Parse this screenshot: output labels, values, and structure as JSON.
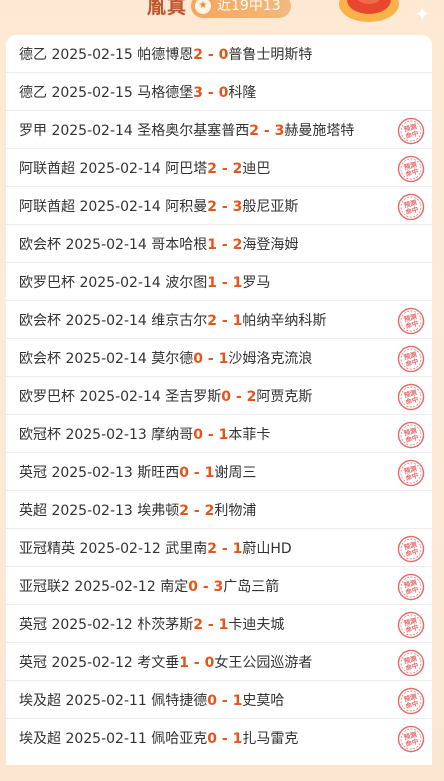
{
  "header": {
    "title": "胤真",
    "badge_icon": "★",
    "badge_text": "近19中13"
  },
  "matches": [
    {
      "league": "德乙",
      "date": "2025-02-15",
      "home": "帕德博恩",
      "home_score": "2",
      "sep": " - ",
      "away_score": "0",
      "away": "普鲁士明斯特",
      "stamp": false
    },
    {
      "league": "德乙",
      "date": "2025-02-15",
      "home": "马格德堡",
      "home_score": "3",
      "sep": " - ",
      "away_score": "0",
      "away": "科隆",
      "stamp": false
    },
    {
      "league": "罗甲",
      "date": "2025-02-14",
      "home": "圣格奥尔基塞普西",
      "home_score": "2",
      "sep": " - ",
      "away_score": "3",
      "away": "赫曼施塔特",
      "stamp": true
    },
    {
      "league": "阿联酋超",
      "date": "2025-02-14",
      "home": "阿巴塔",
      "home_score": "2",
      "sep": " - ",
      "away_score": "2",
      "away": "迪巴",
      "stamp": true
    },
    {
      "league": "阿联酋超",
      "date": "2025-02-14",
      "home": "阿积曼",
      "home_score": "2",
      "sep": " - ",
      "away_score": "3",
      "away": "般尼亚斯",
      "stamp": true
    },
    {
      "league": "欧会杯",
      "date": "2025-02-14",
      "home": "哥本哈根",
      "home_score": "1",
      "sep": " - ",
      "away_score": "2",
      "away": "海登海姆",
      "stamp": false
    },
    {
      "league": "欧罗巴杯",
      "date": "2025-02-14",
      "home": "波尔图",
      "home_score": "1",
      "sep": " - ",
      "away_score": "1",
      "away": "罗马",
      "stamp": false
    },
    {
      "league": "欧会杯",
      "date": "2025-02-14",
      "home": "维京古尔",
      "home_score": "2",
      "sep": " - ",
      "away_score": "1",
      "away": "帕纳辛纳科斯",
      "stamp": true
    },
    {
      "league": "欧会杯",
      "date": "2025-02-14",
      "home": "莫尔德",
      "home_score": "0",
      "sep": " - ",
      "away_score": "1",
      "away": "沙姆洛克流浪",
      "stamp": true
    },
    {
      "league": "欧罗巴杯",
      "date": "2025-02-14",
      "home": "圣吉罗斯",
      "home_score": "0",
      "sep": " - ",
      "away_score": "2",
      "away": "阿贾克斯",
      "stamp": true
    },
    {
      "league": "欧冠杯",
      "date": "2025-02-13",
      "home": "摩纳哥",
      "home_score": "0",
      "sep": " - ",
      "away_score": "1",
      "away": "本菲卡",
      "stamp": true
    },
    {
      "league": "英冠",
      "date": "2025-02-13",
      "home": "斯旺西",
      "home_score": "0",
      "sep": " - ",
      "away_score": "1",
      "away": "谢周三",
      "stamp": true
    },
    {
      "league": "英超",
      "date": "2025-02-13",
      "home": "埃弗顿",
      "home_score": "2",
      "sep": " - ",
      "away_score": "2",
      "away": "利物浦",
      "stamp": false
    },
    {
      "league": "亚冠精英",
      "date": "2025-02-12",
      "home": "武里南",
      "home_score": "2",
      "sep": " - ",
      "away_score": "1",
      "away": "蔚山HD",
      "stamp": true
    },
    {
      "league": "亚冠联2",
      "date": "2025-02-12",
      "home": "南定",
      "home_score": "0",
      "sep": " - ",
      "away_score": "3",
      "away": "广岛三箭",
      "stamp": true
    },
    {
      "league": "英冠",
      "date": "2025-02-12",
      "home": "朴茨茅斯",
      "home_score": "2",
      "sep": " - ",
      "away_score": "1",
      "away": "卡迪夫城",
      "stamp": true
    },
    {
      "league": "英冠",
      "date": "2025-02-12",
      "home": "考文垂",
      "home_score": "1",
      "sep": " - ",
      "away_score": "0",
      "away": "女王公园巡游者",
      "stamp": true
    },
    {
      "league": "埃及超",
      "date": "2025-02-11",
      "home": "佩特捷德",
      "home_score": "0",
      "sep": " - ",
      "away_score": "1",
      "away": "史莫哈",
      "stamp": true
    },
    {
      "league": "埃及超",
      "date": "2025-02-11",
      "home": "佩哈亚克",
      "home_score": "0",
      "sep": " - ",
      "away_score": "1",
      "away": "扎马雷克",
      "stamp": true
    }
  ],
  "stamp_text": {
    "line1": "预测",
    "line2": "命中"
  },
  "colors": {
    "score": "#e4551c",
    "stamp": "#e56a6a",
    "badge": "#f6a65a",
    "title": "#c0552b"
  }
}
